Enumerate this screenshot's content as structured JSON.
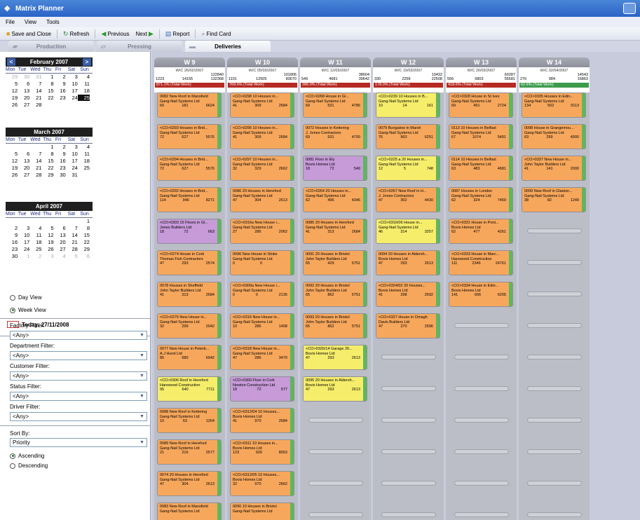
{
  "window": {
    "title": "Matrix Planner"
  },
  "menu": [
    "File",
    "View",
    "Tools"
  ],
  "toolbar": {
    "save_close": "Save and Close",
    "refresh": "Refresh",
    "previous": "Previous",
    "next": "Next",
    "report": "Report",
    "find_card": "Find Card"
  },
  "tabs": [
    "Production",
    "Pressing",
    "Deliveries"
  ],
  "calendar": {
    "day_names": [
      "Mon",
      "Tue",
      "Wed",
      "Thu",
      "Fri",
      "Sat",
      "Sun"
    ],
    "months": [
      {
        "title": "February 2007",
        "cells": [
          "29",
          "30",
          "31",
          "1",
          "2",
          "3",
          "4",
          "5",
          "6",
          "7",
          "8",
          "9",
          "10",
          "11",
          "12",
          "13",
          "14",
          "15",
          "16",
          "17",
          "18",
          "19",
          "20",
          "21",
          "22",
          "23",
          "24",
          "25",
          "26",
          "27",
          "28",
          "",
          "",
          "",
          ""
        ],
        "dim": [
          0,
          1,
          2
        ],
        "selected": 27
      },
      {
        "title": "March 2007",
        "cells": [
          "",
          "",
          "",
          "1",
          "2",
          "3",
          "4",
          "5",
          "6",
          "7",
          "8",
          "9",
          "10",
          "11",
          "12",
          "13",
          "14",
          "15",
          "16",
          "17",
          "18",
          "19",
          "20",
          "21",
          "22",
          "23",
          "24",
          "25",
          "26",
          "27",
          "28",
          "29",
          "30",
          "31",
          ""
        ],
        "dim": [],
        "selected": null
      },
      {
        "title": "April 2007",
        "cells": [
          "",
          "",
          "",
          "",
          "",
          "",
          "1",
          "2",
          "3",
          "4",
          "5",
          "6",
          "7",
          "8",
          "9",
          "10",
          "11",
          "12",
          "13",
          "14",
          "15",
          "16",
          "17",
          "18",
          "19",
          "20",
          "21",
          "22",
          "23",
          "24",
          "25",
          "26",
          "27",
          "28",
          "29",
          "30",
          "1",
          "2",
          "3",
          "4",
          "5",
          "6"
        ],
        "dim": [
          36,
          37,
          38,
          39,
          40,
          41
        ],
        "selected": null
      }
    ],
    "today_label": "Today: 27/11/2008"
  },
  "view": {
    "day": "Day View",
    "week": "Week View"
  },
  "filters": [
    {
      "label": "Factory Filter:",
      "value": "<Any>"
    },
    {
      "label": "Department Filter:",
      "value": "<Any>"
    },
    {
      "label": "Customer Filter:",
      "value": "<Any>"
    },
    {
      "label": "Status Filter:",
      "value": "<Any>"
    },
    {
      "label": "Driver Filter:",
      "value": "<Any>"
    }
  ],
  "sort": {
    "label": "Sort By:",
    "value": "Priority",
    "asc": "Ascending",
    "desc": "Descending"
  },
  "colors": {
    "orange": "#f7a75c",
    "yellow": "#f6ed6b",
    "purple": "#c79ad8",
    "red": "#b52a23",
    "green": "#3d9b4c"
  },
  "weeks": [
    {
      "name": "W 9",
      "wc": "W/C 26/02/2007",
      "total": "122840",
      "nums": [
        "1223",
        "14155",
        "132368"
      ],
      "pct": "871.1% (Total Work)",
      "pct_color": "red",
      "cards": [
        {
          "c": "orange",
          "l1": "0082 New Roof in Mansfield",
          "l2": "Gang-Nail Systems Ltd",
          "a": "60",
          "b": "181",
          "d": "6624"
        },
        {
          "c": "orange",
          "l1": "<CO>0293 Houses in Brid...",
          "l2": "Gang-Nail Systems Ltd",
          "a": "72",
          "b": "627",
          "d": "5576"
        },
        {
          "c": "orange",
          "l1": "<CO>0294 Houses in Brid...",
          "l2": "Gang-Nail Systems Ltd",
          "a": "72",
          "b": "627",
          "d": "5576"
        },
        {
          "c": "orange",
          "l1": "<CO>0292 Houses in Brid...",
          "l2": "Gang-Nail Systems Ltd",
          "a": "114",
          "b": "946",
          "d": "8271"
        },
        {
          "c": "purple",
          "l1": "<CO>0303 15 Floors in Gl...",
          "l2": "Jones Builders Ltd",
          "a": "18",
          "b": "72",
          "d": "663"
        },
        {
          "c": "orange",
          "l1": "<CO>0274 House in Cork",
          "l2": "Thomas Fish Contractors",
          "a": "47",
          "b": "293",
          "d": "2574"
        },
        {
          "c": "orange",
          "l1": "0078 Houses in Sheffield",
          "l2": "John Taylor Builders Ltd",
          "a": "41",
          "b": "313",
          "d": "2684"
        },
        {
          "c": "orange",
          "l1": "<CO>0276 New House in...",
          "l2": "Gang-Nail Systems Ltd",
          "a": "32",
          "b": "299",
          "d": "2042"
        },
        {
          "c": "orange",
          "l1": "0077 New House in Peterb...",
          "l2": "A.J Hurst Ltd",
          "a": "85",
          "b": "680",
          "d": "6942"
        },
        {
          "c": "yellow",
          "l1": "<CO>0306 Roof in Hereford",
          "l2": "Harewood Construction",
          "a": "95",
          "b": "640",
          "d": "7711"
        },
        {
          "c": "orange",
          "l1": "0088 New Roof in Kettering",
          "l2": "Gang-Nail Systems Ltd",
          "a": "10",
          "b": "63",
          "d": "1264"
        },
        {
          "c": "orange",
          "l1": "0089 New Roof in Hereford",
          "l2": "Gang-Nail Systems Ltd",
          "a": "21",
          "b": "216",
          "d": "2577"
        },
        {
          "c": "orange",
          "l1": "0074 20 Houses in Hereford",
          "l2": "Gang-Nail Systems Ltd",
          "a": "47",
          "b": "304",
          "d": "2613"
        },
        {
          "c": "orange",
          "l1": "0083 New Roof in Mansfield",
          "l2": "Gang-Nail Systems Ltd",
          "a": "",
          "b": "",
          "d": ""
        }
      ],
      "empty": 0
    },
    {
      "name": "W 10",
      "wc": "W/C 05/03/2007",
      "total": "101806",
      "nums": [
        "1101",
        "12505",
        "83670"
      ],
      "pct": "769.6% (Total Work)",
      "pct_color": "red",
      "cards": [
        {
          "c": "orange",
          "l1": "<CO>0298 10 Houses in...",
          "l2": "Gang-Nail Systems Ltd",
          "a": "41",
          "b": "309",
          "d": "2684"
        },
        {
          "c": "orange",
          "l1": "<CO>0295 10 Houses in...",
          "l2": "Gang-Nail Systems Ltd",
          "a": "41",
          "b": "309",
          "d": "2684"
        },
        {
          "c": "orange",
          "l1": "<CO>0297 10 Houses in...",
          "l2": "Gang-Nail Systems Ltd",
          "a": "32",
          "b": "329",
          "d": "2662"
        },
        {
          "c": "orange",
          "l1": "0086 20 Houses in Hereford",
          "l2": "Gang-Nail Systems Ltd",
          "a": "47",
          "b": "304",
          "d": "2613"
        },
        {
          "c": "orange",
          "l1": "<CO>0316a New House i...",
          "l2": "Gang-Nail Systems Ltd",
          "a": "27",
          "b": "286",
          "d": "2062"
        },
        {
          "c": "orange",
          "l1": "0096 New House in Stoke",
          "l2": "Gang-Nail Systems Ltd",
          "a": "0",
          "b": "0",
          "d": ""
        },
        {
          "c": "orange",
          "l1": "<CO>0309a New House i...",
          "l2": "Gang-Nail Systems Ltd",
          "a": "0",
          "b": "0",
          "d": "2135"
        },
        {
          "c": "orange",
          "l1": "<CO>0316 New House in...",
          "l2": "Gang-Nail Systems Ltd",
          "a": "10",
          "b": "286",
          "d": "1408"
        },
        {
          "c": "orange",
          "l1": "<CO>0318 New House in...",
          "l2": "Gang-Nail Systems Ltd",
          "a": "47",
          "b": "286",
          "d": "3470"
        },
        {
          "c": "purple",
          "l1": "<CO>0300 Floor in Cork",
          "l2": "Newton Construction Ltd",
          "a": "18",
          "b": "72",
          "d": "577"
        },
        {
          "c": "orange",
          "l1": "<CO>0312/04 10 Houses...",
          "l2": "Bovis Homes Ltd",
          "a": "41",
          "b": "970",
          "d": "2684"
        },
        {
          "c": "orange",
          "l1": "<CO>0311 10 Houses in...",
          "l2": "Bovis Homes Ltd",
          "a": "123",
          "b": "926",
          "d": "8053"
        },
        {
          "c": "orange",
          "l1": "<CO>0312/05 10 Houses...",
          "l2": "Bovis Homes Ltd",
          "a": "32",
          "b": "970",
          "d": "2662"
        },
        {
          "c": "orange",
          "l1": "0090 10 Houses in Bristol",
          "l2": "Gang-Nail Systems Ltd",
          "a": "",
          "b": "",
          "d": ""
        }
      ],
      "empty": 0
    },
    {
      "name": "W 11",
      "wc": "W/C 12/03/2007",
      "total": "38604",
      "nums": [
        "549",
        "4681",
        "39642"
      ],
      "pct": "286.0% (Total Work)",
      "pct_color": "red",
      "cards": [
        {
          "c": "orange",
          "l1": "<CO>0268 House in Gl...",
          "l2": "Gang-Nail Systems Ltd",
          "a": "69",
          "b": "531",
          "d": "4786"
        },
        {
          "c": "orange",
          "l1": "0072 Houses in Kettering",
          "l2": "J. Jones Contractors",
          "a": "69",
          "b": "531",
          "d": "4700"
        },
        {
          "c": "purple",
          "l1": "0081 Floor in Ely",
          "l2": "Bovis Homes Ltd",
          "a": "18",
          "b": "72",
          "d": "549"
        },
        {
          "c": "orange",
          "l1": "<CO>0264 20 Houses in...",
          "l2": "Gang-Nail Systems Ltd",
          "a": "62",
          "b": "496",
          "d": "4346"
        },
        {
          "c": "orange",
          "l1": "0085 20 Houses in Hereford",
          "l2": "Gang-Nail Systems Ltd",
          "a": "41",
          "b": "313",
          "d": "2684"
        },
        {
          "c": "orange",
          "l1": "0091 20 Houses in Bristol",
          "l2": "John Taylor Builders Ltd",
          "a": "65",
          "b": "429",
          "d": "5751"
        },
        {
          "c": "orange",
          "l1": "0092 20 Houses in Bristol",
          "l2": "John Taylor Builders Ltd",
          "a": "65",
          "b": "862",
          "d": "5751"
        },
        {
          "c": "orange",
          "l1": "0093 20 Houses in Bristol",
          "l2": "John Taylor Builders Ltd",
          "a": "65",
          "b": "862",
          "d": "5751"
        },
        {
          "c": "yellow",
          "l1": "<CO>0326/14 Garage 20...",
          "l2": "Bovis Homes Ltd",
          "a": "47",
          "b": "293",
          "d": "2613"
        },
        {
          "c": "yellow",
          "l1": "0095 20 Houses in Aldersh...",
          "l2": "Bovis Homes Ltd",
          "a": "47",
          "b": "293",
          "d": "2613"
        }
      ],
      "empty": 4
    },
    {
      "name": "W 12",
      "wc": "W/C 19/03/2007",
      "total": "19432",
      "nums": [
        "330",
        "2258",
        "22508"
      ],
      "pct": "178.0% (Total Work)",
      "pct_color": "red",
      "cards": [
        {
          "c": "yellow",
          "l1": "<CO>0239 10 Houses in B...",
          "l2": "Gang-Nail Systems Ltd",
          "a": "10",
          "b": "14",
          "d": "161"
        },
        {
          "c": "orange",
          "l1": "0079 Bungalow in Marsh",
          "l2": "Gang-Nail Systems Ltd",
          "a": "76",
          "b": "963",
          "d": "6251"
        },
        {
          "c": "yellow",
          "l1": "<CO>0225 a 20 Houses in...",
          "l2": "Gang-Nail Systems Ltd",
          "a": "12",
          "b": "5",
          "d": "748"
        },
        {
          "c": "orange",
          "l1": "<CO>0267 New Roof in H...",
          "l2": "J. Jones Contractors",
          "a": "47",
          "b": "302",
          "d": "4430"
        },
        {
          "c": "yellow",
          "l1": "<CO>0316/06 House in...",
          "l2": "Gang-Nail Systems Ltd",
          "a": "46",
          "b": "314",
          "d": "3257"
        },
        {
          "c": "orange",
          "l1": "0094 20 Houses in Aldersh...",
          "l2": "Bovis Homes Ltd",
          "a": "47",
          "b": "293",
          "d": "2613"
        },
        {
          "c": "orange",
          "l1": "<CO>0324/02 20 Houses...",
          "l2": "Bovis Homes Ltd",
          "a": "41",
          "b": "298",
          "d": "2692"
        },
        {
          "c": "orange",
          "l1": "<CO>0327 House in Omagh",
          "l2": "Davis Builders Ltd",
          "a": "47",
          "b": "270",
          "d": "2596"
        }
      ],
      "empty": 6
    },
    {
      "name": "W 13",
      "wc": "W/C 26/03/2007",
      "total": "60287",
      "nums": [
        "556",
        "6803",
        "55581"
      ],
      "pct": "418.6% (Total Work)",
      "pct_color": "red",
      "cards": [
        {
          "c": "orange",
          "l1": "<CO>0328 House in St Ives",
          "l2": "Gang-Nail Systems Ltd",
          "a": "69",
          "b": "491",
          "d": "2724"
        },
        {
          "c": "orange",
          "l1": "0113 10 Houses in Belfast",
          "l2": "Gang-Nail Systems Ltd",
          "a": "67",
          "b": "1074",
          "d": "5491"
        },
        {
          "c": "orange",
          "l1": "0114 10 Houses in Belfast",
          "l2": "Gang-Nail Systems Ltd",
          "a": "63",
          "b": "483",
          "d": "4681"
        },
        {
          "c": "orange",
          "l1": "0087 Houses in London",
          "l2": "Gang-Nail Systems Ltd",
          "a": "62",
          "b": "324",
          "d": "7469"
        },
        {
          "c": "orange",
          "l1": "<CO>0331 House in Pont...",
          "l2": "Bovis Homes Ltd",
          "a": "62",
          "b": "477",
          "d": "4261"
        },
        {
          "c": "orange",
          "l1": "<CO>0333 House in Marc...",
          "l2": "Harewood Construction",
          "a": "111",
          "b": "2346",
          "d": "24761"
        },
        {
          "c": "orange",
          "l1": "<CO>0334 House in Edin...",
          "l2": "Bovis Homes Ltd",
          "a": "141",
          "b": "606",
          "d": "6205"
        }
      ],
      "empty": 7
    },
    {
      "name": "W 14",
      "wc": "W/C 02/04/2007",
      "total": "14543",
      "nums": [
        "276",
        "984",
        "16863"
      ],
      "pct": "62.6% (Total Work)",
      "pct_color": "green",
      "cards": [
        {
          "c": "orange",
          "l1": "<CO>0335 Houses in Edin...",
          "l2": "Gang-Nail Systems Ltd",
          "a": "134",
          "b": "502",
          "d": "9113"
        },
        {
          "c": "orange",
          "l1": "0098 House in Grangemou...",
          "l2": "Gang-Nail Systems Ltd",
          "a": "63",
          "b": "299",
          "d": "4900"
        },
        {
          "c": "orange",
          "l1": "<CO>0337 New House in...",
          "l2": "John Taylor Builders Ltd",
          "a": "41",
          "b": "141",
          "d": "2000"
        },
        {
          "c": "orange",
          "l1": "0099 New Roof in Glaston...",
          "l2": "Gang-Nail Systems Ltd",
          "a": "38",
          "b": "82",
          "d": "1249"
        }
      ],
      "empty": 10
    }
  ]
}
